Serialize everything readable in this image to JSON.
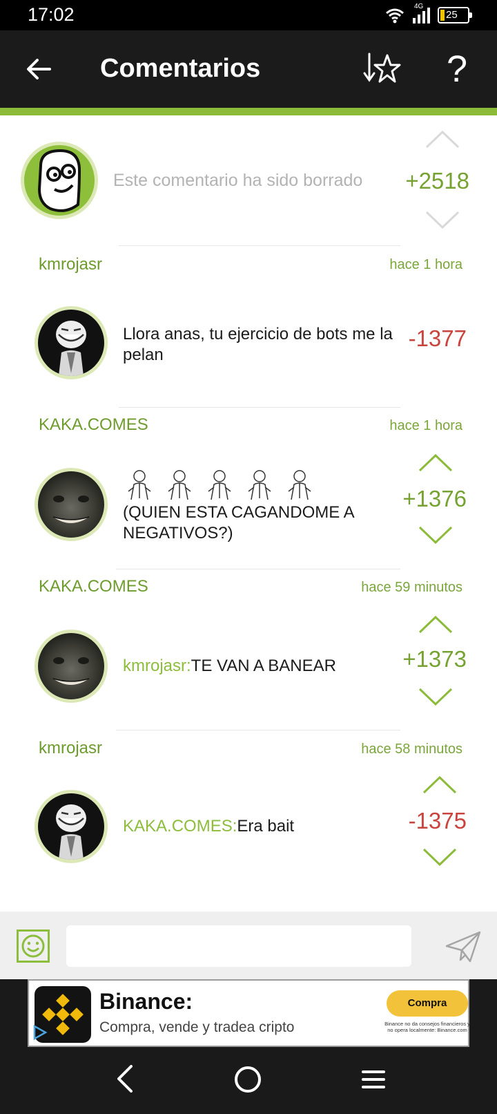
{
  "status": {
    "time": "17:02",
    "network": "4G",
    "battery": "25"
  },
  "app_bar": {
    "title": "Comentarios"
  },
  "comments": [
    {
      "author": "",
      "timestamp": "",
      "text": "Este comentario ha sido borrado",
      "score": "+2518",
      "avatar": "meme-face"
    },
    {
      "author": "kmrojasr",
      "timestamp": "hace 1 hora",
      "text": "Llora anas, tu ejercicio de bots me la pelan",
      "score": "-1377",
      "avatar": "troll-suit"
    },
    {
      "author": "KAKA.COMES",
      "timestamp": "hace 1 hora",
      "text": "(QUIEN ESTA CAGANDOME A NEGATIVOS?)",
      "score": "+1376",
      "avatar": "grinning-cat"
    },
    {
      "author": "KAKA.COMES",
      "timestamp": "hace 59 minutos",
      "mention": "kmrojasr:",
      "text": "TE VAN A BANEAR",
      "score": "+1373",
      "avatar": "grinning-cat"
    },
    {
      "author": "kmrojasr",
      "timestamp": "hace 58 minutos",
      "mention": "KAKA.COMES:",
      "text": "Era bait",
      "score": "-1375",
      "avatar": "troll-suit"
    }
  ],
  "input": {
    "placeholder": ""
  },
  "ad": {
    "title": "Binance:",
    "subtitle": "Compra, vende y tradea cripto",
    "cta": "Compra",
    "disclaimer": "Binance no da consejos financieros y no opera localmente: Binance.com"
  },
  "colors": {
    "accent": "#8cbb3a",
    "positive": "#76a232",
    "negative": "#c9443c",
    "header": "#1b1b1b"
  }
}
